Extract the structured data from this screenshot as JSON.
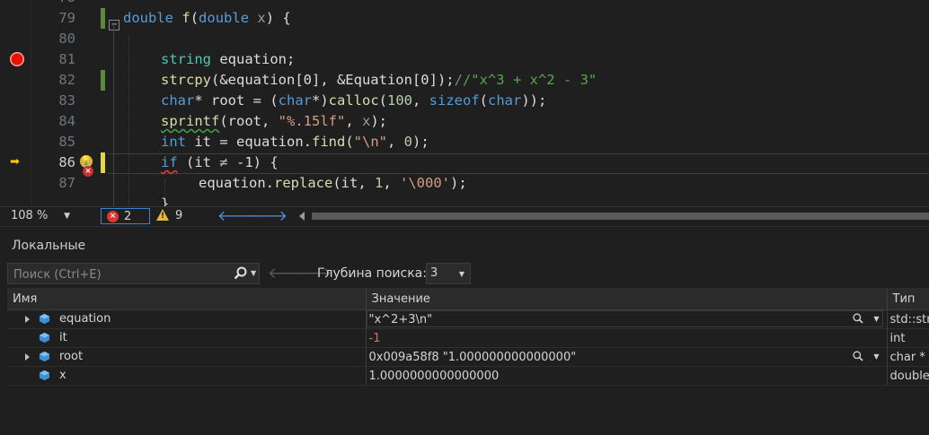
{
  "editor": {
    "line_numbers": [
      "79",
      "80",
      "81",
      "82",
      "83",
      "84",
      "85",
      "86",
      "87"
    ],
    "code": {
      "l79": {
        "t1": "double",
        "t2": "f",
        "t3": "(",
        "t4": "double",
        "t5": "x",
        "t6": ") {"
      },
      "l81": {
        "t1": "string",
        "t2": "equation;"
      },
      "l82": {
        "t1": "strcpy",
        "t2": "(&equation[0], &Equation[0]);",
        "t3": "//\"x^3 + x^2 - 3\""
      },
      "l83": {
        "t1": "char",
        "t2": "* root = (",
        "t3": "char",
        "t4": "*)",
        "t5": "calloc",
        "t6": "(",
        "t7": "100",
        ",": ", ",
        "t8": "sizeof",
        "t9": "(",
        "t10": "char",
        "t11": "));"
      },
      "l84": {
        "t1": "sprintf",
        "t2": "(root, ",
        "t3": "\"%.15lf\"",
        ",": ", ",
        "t4": "x",
        "t5": ");"
      },
      "l85": {
        "t1": "int",
        "t2": " it = equation.",
        "t3": "find",
        "t4": "(",
        "t5": "\"\\n\"",
        "t6": ", ",
        "t7": "0",
        "t8": ");"
      },
      "l86": {
        "t1": "if",
        "t2": " (it ",
        "t3": "≠",
        "t4": " -1) {"
      },
      "l87": {
        "t1": "equation.",
        "t2": "replace",
        "t3": "(it, ",
        "t4": "1",
        "t5": ", ",
        "t6": "'\\000'",
        "t7": ");"
      }
    },
    "colors": {
      "breakpoint": "#e51400",
      "current_arrow": "#ffcc00"
    }
  },
  "status": {
    "zoom": "108 %",
    "errors": "2",
    "warnings": "9",
    "back_icon": "arrow-left-icon",
    "forward_icon": "arrow-right-icon"
  },
  "locals": {
    "title": "Локальные",
    "search_placeholder": "Поиск (Ctrl+E)",
    "depth_label": "Глубина поиска:",
    "depth_value": "3",
    "columns": {
      "name": "Имя",
      "value": "Значение",
      "type": "Тип"
    },
    "rows": [
      {
        "name": "equation",
        "value": "\"x^2+3\\n\"",
        "type": "std::string"
      },
      {
        "name": "it",
        "value": "-1",
        "type": "int"
      },
      {
        "name": "root",
        "value": "0x009a58f8 \"1.000000000000000\"",
        "type": "char *"
      },
      {
        "name": "x",
        "value": "1.0000000000000000",
        "type": "double"
      }
    ]
  }
}
